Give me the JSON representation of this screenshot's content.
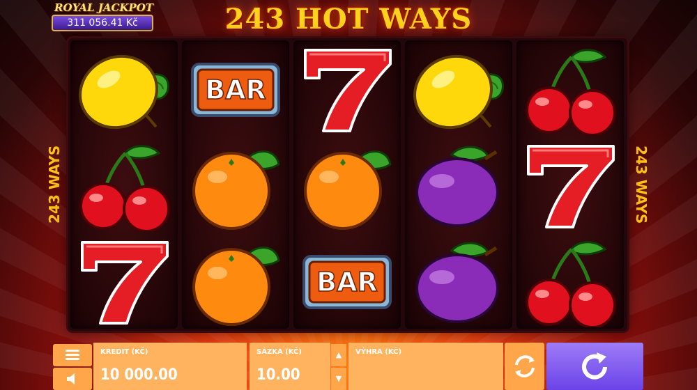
{
  "jackpot": {
    "title": "ROYAL JACKPOT",
    "amount": "311 056.41 Kč"
  },
  "game": {
    "title": "243 HOT WAYS",
    "side_label": "243 WAYS"
  },
  "reels": [
    [
      "lemon",
      "cherry",
      "seven"
    ],
    [
      "bar",
      "orange",
      "orange"
    ],
    [
      "seven",
      "orange",
      "bar"
    ],
    [
      "lemon",
      "plum",
      "plum"
    ],
    [
      "cherry",
      "seven",
      "cherry"
    ]
  ],
  "symbols": {
    "bar_text": "BAR"
  },
  "bottom": {
    "credit_label": "KREDIT (KČ)",
    "credit_value": "10 000.00",
    "bet_label": "SÁZKA (KČ)",
    "bet_value": "10.00",
    "win_label": "VÝHRA (KČ)",
    "win_value": "",
    "bet_up": "▲",
    "bet_down": "▼"
  },
  "colors": {
    "accent_orange": "#ffa64a",
    "spin_purple": "#7b55ee",
    "title_gold": "#ffd21c"
  },
  "icons": {
    "menu": "menu-icon",
    "sound": "speaker-mute-icon",
    "autoplay": "autoplay-icon",
    "spin": "spin-icon"
  }
}
